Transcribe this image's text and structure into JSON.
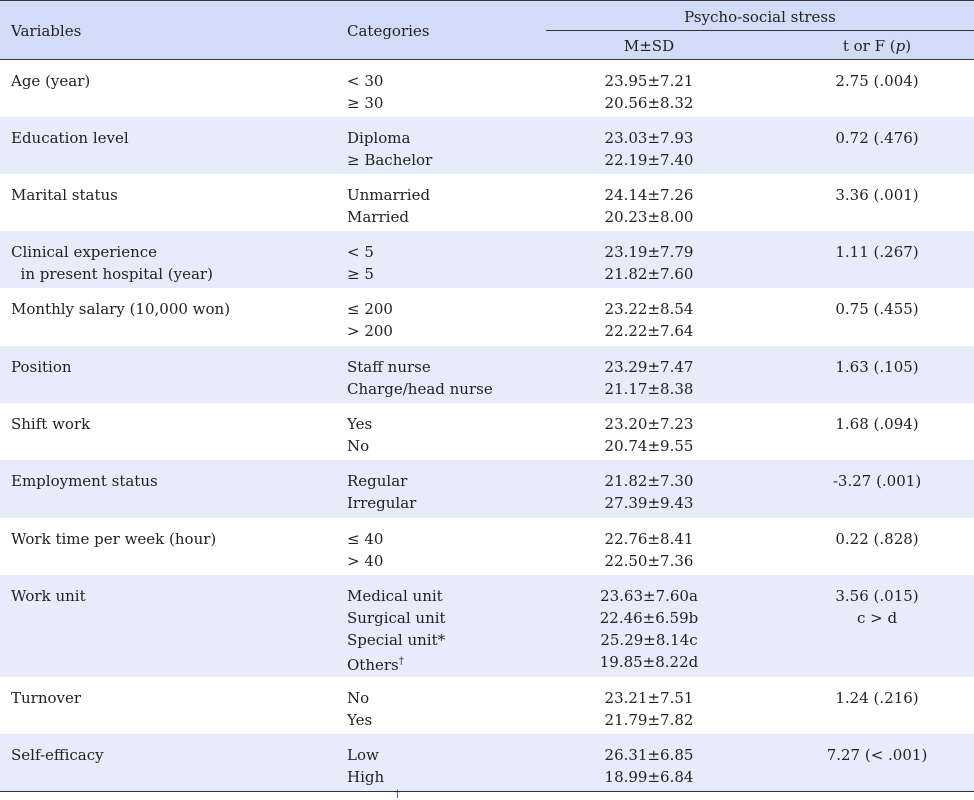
{
  "header": {
    "variables": "Variables",
    "categories": "Categories",
    "group": "Psycho-social stress",
    "msd": "M±SD",
    "tf": "t or F (",
    "tf_p": "p",
    "tf_close": ")"
  },
  "rows": [
    {
      "var": [
        "Age (year)"
      ],
      "cats": [
        "< 30",
        "≥ 30"
      ],
      "msd": [
        "23.95±7.21",
        "20.56±8.32"
      ],
      "stat": [
        "2.75 (.004)"
      ]
    },
    {
      "var": [
        "Education level"
      ],
      "cats": [
        "Diploma",
        "≥ Bachelor"
      ],
      "msd": [
        "23.03±7.93",
        "22.19±7.40"
      ],
      "stat": [
        "0.72 (.476)"
      ]
    },
    {
      "var": [
        "Marital status"
      ],
      "cats": [
        "Unmarried",
        "Married"
      ],
      "msd": [
        "24.14±7.26",
        "20.23±8.00"
      ],
      "stat": [
        "3.36 (.001)"
      ]
    },
    {
      "var": [
        "Clinical experience",
        "  in present hospital (year)"
      ],
      "cats": [
        "< 5",
        "≥ 5"
      ],
      "msd": [
        "23.19±7.79",
        "21.82±7.60"
      ],
      "stat": [
        "1.11 (.267)"
      ]
    },
    {
      "var": [
        "Monthly salary (10,000 won)"
      ],
      "cats": [
        "≤ 200",
        "> 200"
      ],
      "msd": [
        "23.22±8.54",
        "22.22±7.64"
      ],
      "stat": [
        "0.75 (.455)"
      ]
    },
    {
      "var": [
        "Position"
      ],
      "cats": [
        "Staff nurse",
        "Charge/head nurse"
      ],
      "msd": [
        "23.29±7.47",
        "21.17±8.38"
      ],
      "stat": [
        "1.63 (.105)"
      ]
    },
    {
      "var": [
        "Shift work"
      ],
      "cats": [
        "Yes",
        "No"
      ],
      "msd": [
        "23.20±7.23",
        "20.74±9.55"
      ],
      "stat": [
        "1.68 (.094)"
      ]
    },
    {
      "var": [
        "Employment status"
      ],
      "cats": [
        "Regular",
        "Irregular"
      ],
      "msd": [
        "21.82±7.30",
        "27.39±9.43"
      ],
      "stat": [
        "-3.27 (.001)"
      ]
    },
    {
      "var": [
        "Work time per week (hour)"
      ],
      "cats": [
        "≤ 40",
        "> 40"
      ],
      "msd": [
        "22.76±8.41",
        "22.50±7.36"
      ],
      "stat": [
        "0.22 (.828)"
      ]
    },
    {
      "var": [
        "Work unit"
      ],
      "cats": [
        "Medical unit",
        "Surgical unit",
        "Special unit*",
        "Others"
      ],
      "msd": [
        "23.63±7.60a",
        "22.46±6.59b",
        "25.29±8.14c",
        "19.85±8.22d"
      ],
      "stat": [
        "3.56 (.015)",
        "c > d"
      ]
    },
    {
      "var": [
        "Turnover"
      ],
      "cats": [
        "No",
        "Yes"
      ],
      "msd": [
        "23.21±7.51",
        "21.79±7.82"
      ],
      "stat": [
        "1.24 (.216)"
      ]
    },
    {
      "var": [
        "Self-efficacy"
      ],
      "cats": [
        "Low",
        "High"
      ],
      "msd": [
        "26.31±6.85",
        "18.99±6.84"
      ],
      "stat": [
        "7.27 (< .001)"
      ]
    }
  ],
  "marks": {
    "dagger": "†"
  },
  "colors": {
    "header_bg": "#d3dcf6",
    "shade_bg": "#e7ecfb"
  }
}
